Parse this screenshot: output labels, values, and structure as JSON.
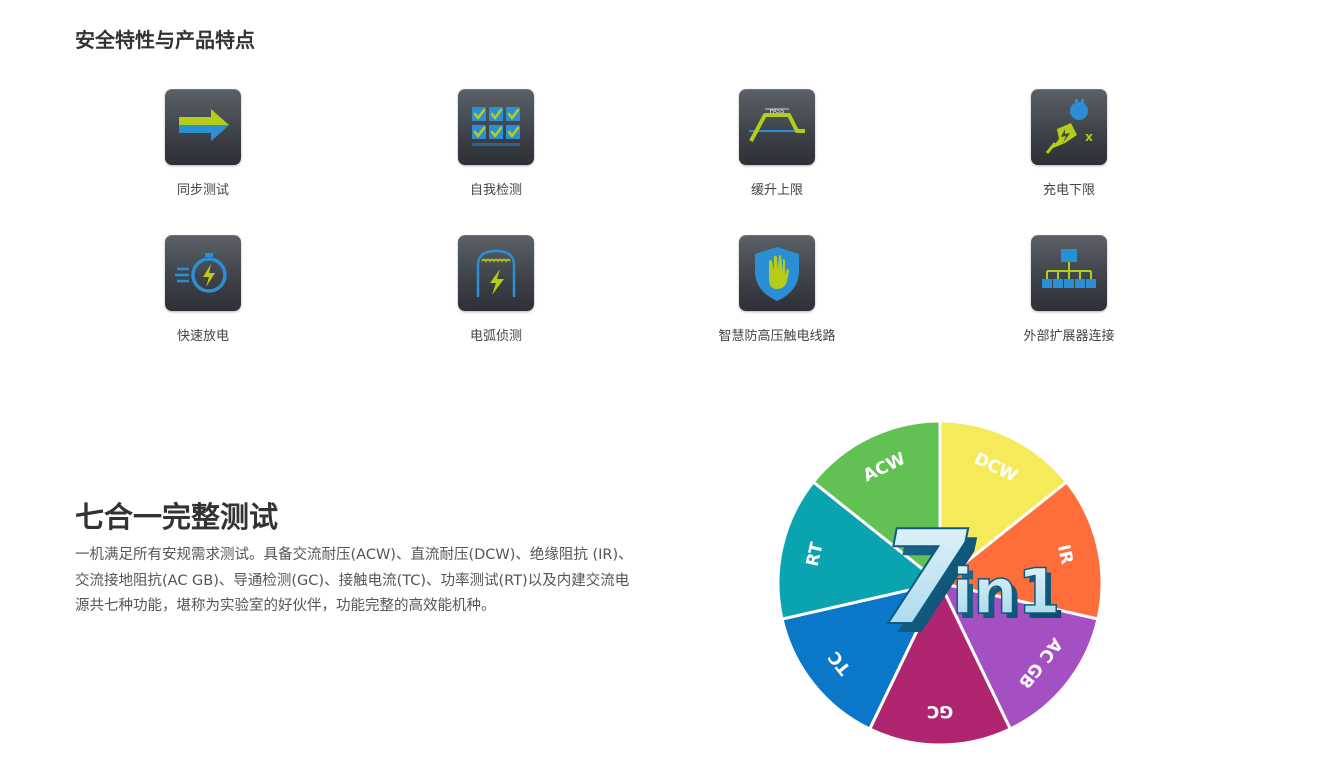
{
  "section": {
    "title": "安全特性与产品特点"
  },
  "features": [
    {
      "label": "同步测试",
      "icon": "arrow-right-icon"
    },
    {
      "label": "自我检测",
      "icon": "checklist-grid-icon"
    },
    {
      "label": "缓升上限",
      "icon": "ramp-pass-icon"
    },
    {
      "label": "充电下限",
      "icon": "plug-charge-icon"
    },
    {
      "label": "快速放电",
      "icon": "stopwatch-bolt-icon"
    },
    {
      "label": "电弧侦测",
      "icon": "arc-bolt-icon"
    },
    {
      "label": "智慧防高压触电线路",
      "icon": "shield-hand-icon"
    },
    {
      "label": "外部扩展器连接",
      "icon": "network-tree-icon"
    }
  ],
  "icon_texts": {
    "pass": "PASS",
    "x": "x"
  },
  "main": {
    "heading": "七合一完整测试",
    "description": "一机满足所有安规需求测试。具备交流耐压(ACW)、直流耐压(DCW)、绝缘阻抗 (IR)、交流接地阻抗(AC GB)、导通检测(GC)、接触电流(TC)、功率测试(RT)以及内建交流电源共七种功能，堪称为实验室的好伙伴，功能完整的高效能机种。"
  },
  "wheel": {
    "center_text": {
      "digit": "7",
      "word": "in1"
    },
    "segments": [
      {
        "label": "DCW",
        "color": "#f4ea5a"
      },
      {
        "label": "IR",
        "color": "#ff6d3a"
      },
      {
        "label": "AC GB",
        "color": "#a44fc2"
      },
      {
        "label": "GC",
        "color": "#b0256f"
      },
      {
        "label": "TC",
        "color": "#0b77c9"
      },
      {
        "label": "RT",
        "color": "#0aa4b0"
      },
      {
        "label": "ACW",
        "color": "#62c153"
      }
    ],
    "colors": {
      "accent_green": "#b5cc18",
      "accent_blue": "#2a8fd4",
      "tile_dark": "#3f434a"
    }
  }
}
